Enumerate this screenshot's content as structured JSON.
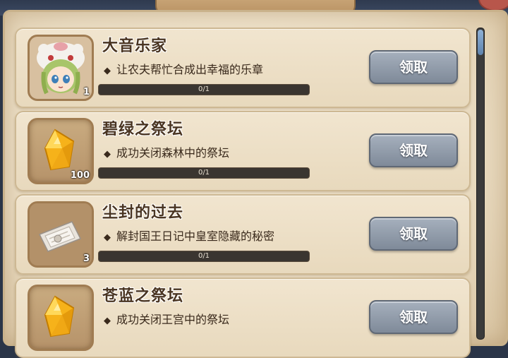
{
  "colors": {
    "panel_bg": "#eadcc2",
    "title_text": "#4a3522",
    "button_gray": "#8f9aa8",
    "progress_track": "#3a3530"
  },
  "quests": [
    {
      "title": "大音乐家",
      "description": "让农夫帮忙合成出幸福的乐章",
      "reward_icon": "chibi-character-icon",
      "reward_count": "1",
      "progress_text": "0/1",
      "progress_fraction": 0,
      "button_label": "领取"
    },
    {
      "title": "碧绿之祭坛",
      "description": "成功关闭森林中的祭坛",
      "reward_icon": "yellow-gem-icon",
      "reward_count": "100",
      "progress_text": "0/1",
      "progress_fraction": 0,
      "button_label": "领取"
    },
    {
      "title": "尘封的过去",
      "description": "解封国王日记中皇室隐藏的秘密",
      "reward_icon": "letter-scroll-icon",
      "reward_count": "3",
      "progress_text": "0/1",
      "progress_fraction": 0,
      "button_label": "领取"
    },
    {
      "title": "苍蓝之祭坛",
      "description": "成功关闭王宫中的祭坛",
      "reward_icon": "yellow-gem-icon",
      "reward_count": "",
      "progress_text": "",
      "progress_fraction": 0,
      "button_label": "领取"
    }
  ],
  "bullet_glyph": "◆",
  "scroll_position": 0.0
}
